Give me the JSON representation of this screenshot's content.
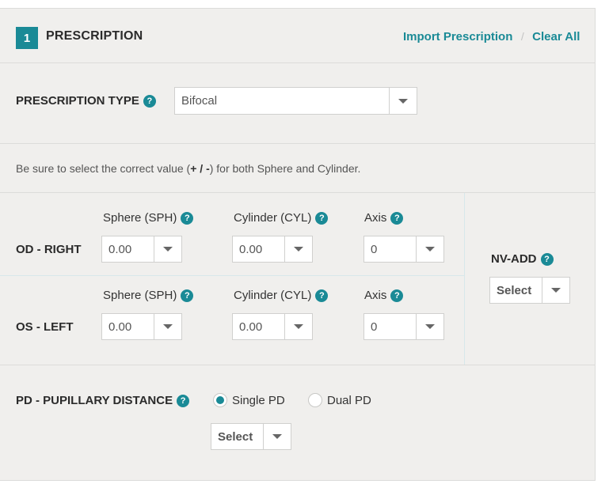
{
  "header": {
    "step_number": "1",
    "title": "PRESCRIPTION",
    "import_link": "Import Prescription",
    "separator": "/",
    "clear_link": "Clear All"
  },
  "prescription_type": {
    "label": "PRESCRIPTION TYPE",
    "help": "?",
    "selected": "Bifocal"
  },
  "note": {
    "prefix": "Be sure to select the correct value (",
    "plus_minus": "+ / -",
    "suffix": ") for both Sphere and Cylinder."
  },
  "columns": {
    "sphere": "Sphere (SPH)",
    "cylinder": "Cylinder (CYL)",
    "axis": "Axis"
  },
  "od": {
    "label": "OD - RIGHT",
    "sphere": "0.00",
    "cylinder": "0.00",
    "axis": "0"
  },
  "os": {
    "label": "OS - LEFT",
    "sphere": "0.00",
    "cylinder": "0.00",
    "axis": "0"
  },
  "nv_add": {
    "label": "NV-ADD",
    "selected": "Select"
  },
  "pd": {
    "label": "PD - PUPILLARY DISTANCE",
    "options": [
      "Single PD",
      "Dual PD"
    ],
    "selected_option": "Single PD",
    "selected": "Select"
  },
  "colors": {
    "accent": "#1a8a96",
    "panel_bg": "#f0efed",
    "border": "#dcdcda"
  }
}
